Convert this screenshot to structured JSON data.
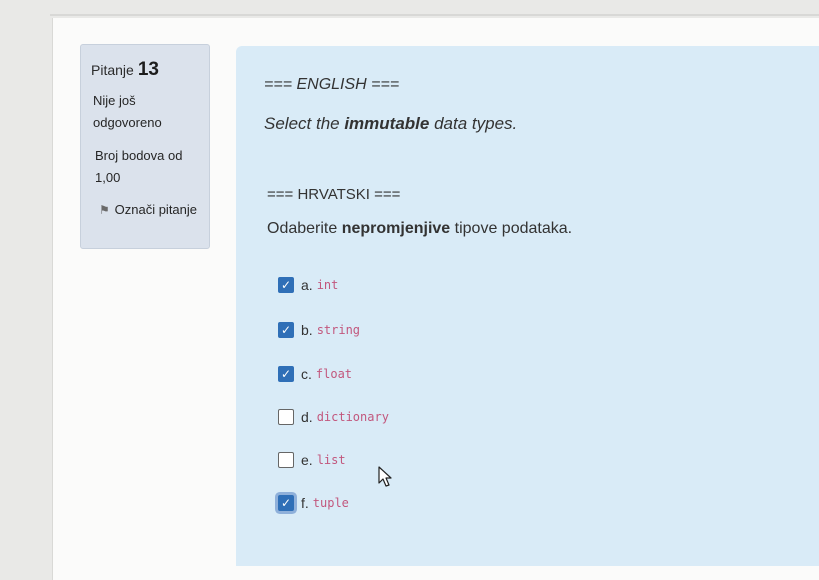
{
  "question": {
    "label": "Pitanje",
    "number": "13",
    "status": "Nije još odgovoreno",
    "points": "Broj bodova od 1,00",
    "flag_label": "Označi pitanje"
  },
  "content": {
    "english_header": "=== ENGLISH ===",
    "english_question_pre": "Select the ",
    "english_question_bold": "immutable",
    "english_question_post": " data types.",
    "croatian_header": "=== HRVATSKI ===",
    "croatian_question_pre": "Odaberite ",
    "croatian_question_bold": "nepromjenjive",
    "croatian_question_post": " tipove podataka."
  },
  "options": [
    {
      "letter": "a.",
      "text": "int",
      "checked": true
    },
    {
      "letter": "b.",
      "text": "string",
      "checked": true
    },
    {
      "letter": "c.",
      "text": "float",
      "checked": true
    },
    {
      "letter": "d.",
      "text": "dictionary",
      "checked": false
    },
    {
      "letter": "e.",
      "text": "list",
      "checked": false
    },
    {
      "letter": "f.",
      "text": "tuple",
      "checked": true
    }
  ],
  "colors": {
    "accent": "#2f6fb7",
    "content_bg": "#d9ebf7",
    "info_bg": "#dbe2ec",
    "code": "#c2577d"
  },
  "icons": {
    "flag": "flag-icon",
    "cursor": "mouse-pointer-icon"
  }
}
